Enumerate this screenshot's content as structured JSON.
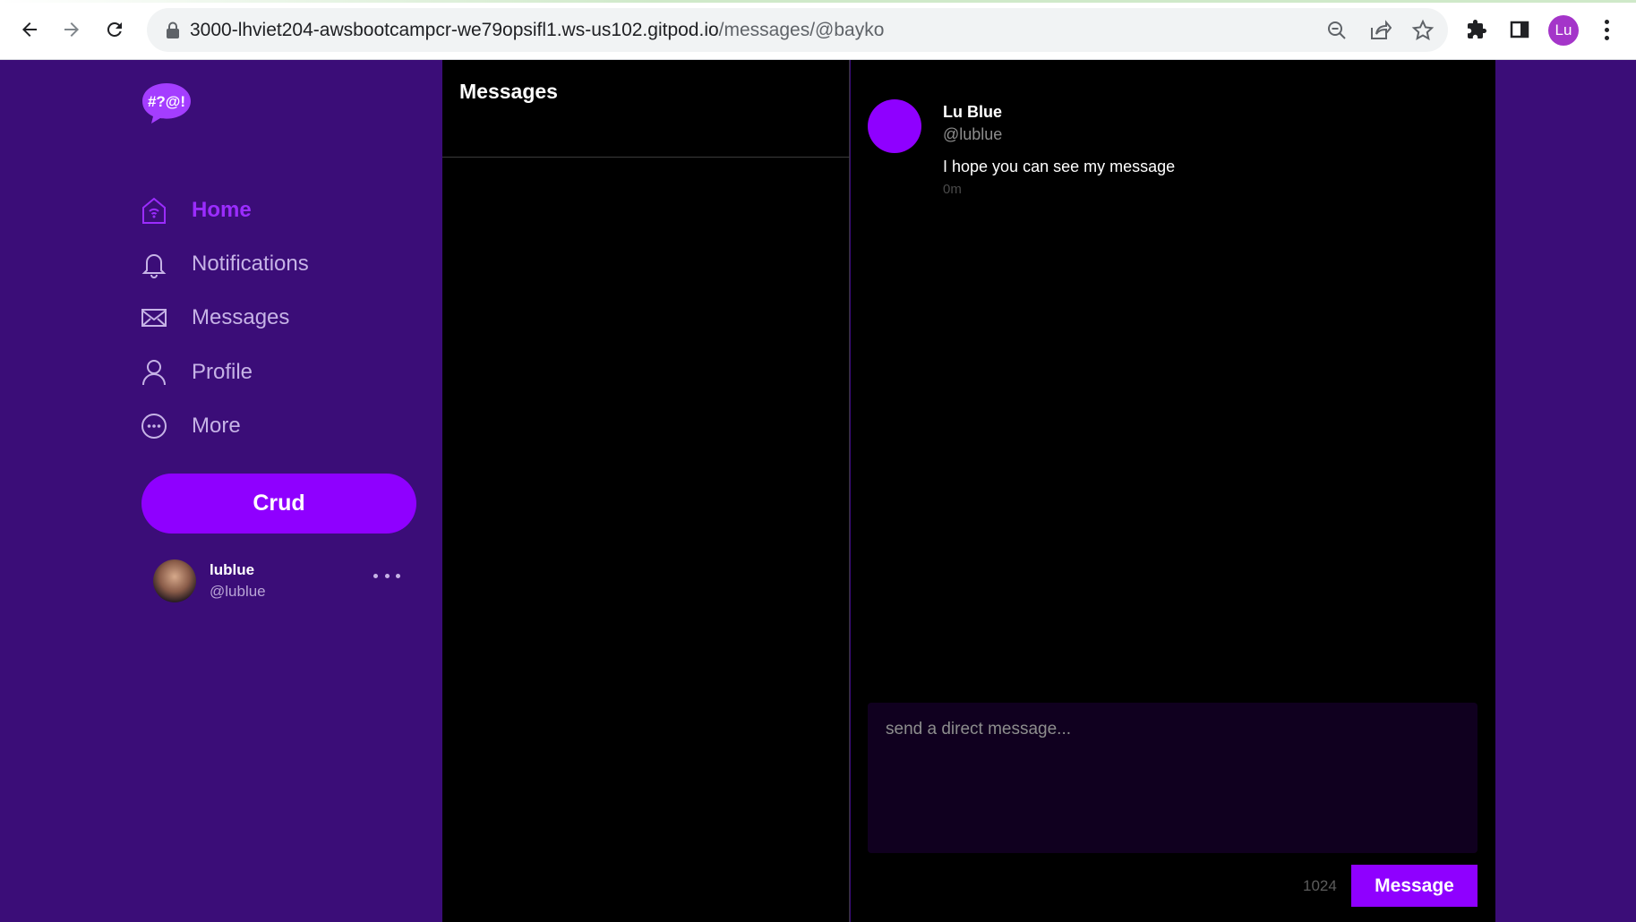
{
  "browser": {
    "url_host": "3000-lhviet204-awsbootcampcr-we79opsifl1.ws-us102.gitpod.io",
    "url_path": "/messages/@bayko",
    "profile_initials": "Lu",
    "icons": [
      "back-arrow-icon",
      "forward-arrow-icon",
      "reload-icon",
      "lock-icon",
      "zoom-out-icon",
      "share-icon",
      "bookmark-star-icon",
      "extensions-puzzle-icon",
      "side-panel-icon",
      "kebab-menu-icon"
    ]
  },
  "sidebar": {
    "logo_text": "#?@!",
    "items": [
      {
        "label": "Home",
        "icon": "home-icon",
        "active": true
      },
      {
        "label": "Notifications",
        "icon": "bell-icon",
        "active": false
      },
      {
        "label": "Messages",
        "icon": "envelope-icon",
        "active": false
      },
      {
        "label": "Profile",
        "icon": "user-icon",
        "active": false
      },
      {
        "label": "More",
        "icon": "more-circle-icon",
        "active": false
      }
    ],
    "crud_label": "Crud",
    "user": {
      "display_name": "lublue",
      "handle": "@lublue"
    }
  },
  "message_groups": {
    "title": "Messages"
  },
  "conversation": {
    "messages": [
      {
        "display_name": "Lu Blue",
        "handle": "@lublue",
        "text": "I hope you can see my message",
        "time": "0m"
      }
    ],
    "composer": {
      "placeholder": "send a direct message...",
      "char_count": "1024",
      "send_label": "Message"
    }
  },
  "colors": {
    "sidebar_bg": "#3b0d78",
    "accent": "#8f00ff",
    "panel_bg": "#000000"
  }
}
